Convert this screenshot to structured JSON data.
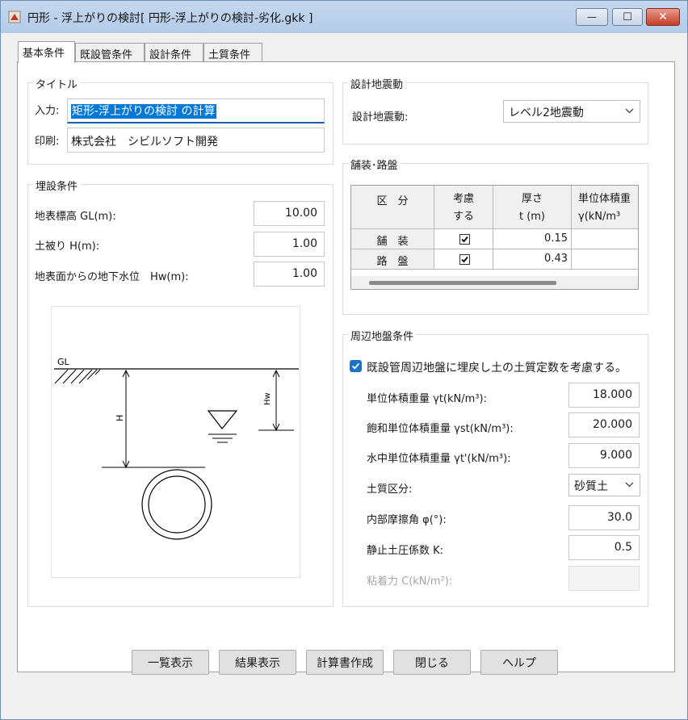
{
  "window": {
    "title": "円形 - 浮上がりの検討[ 円形-浮上がりの検討-劣化.gkk ]",
    "min_glyph": "—",
    "max_glyph": "☐",
    "close_glyph": "✕"
  },
  "tabs": [
    {
      "label": "基本条件",
      "active": true
    },
    {
      "label": "既設管条件",
      "active": false
    },
    {
      "label": "設計条件",
      "active": false
    },
    {
      "label": "土質条件",
      "active": false
    }
  ],
  "title_group": {
    "title": "タイトル",
    "input_label": "入力:",
    "input_value": "矩形-浮上がりの検討 の計算",
    "print_label": "印刷:",
    "print_value": "株式会社　シビルソフト開発"
  },
  "burial": {
    "title": "埋設条件",
    "gl_label": "地表標高 GL(m):",
    "gl_value": "10.00",
    "cover_label": "土被り H(m):",
    "cover_value": "1.00",
    "water_label": "地表面からの地下水位　Hw(m):",
    "water_value": "1.00"
  },
  "diagram": {
    "gl": "GL",
    "h": "H",
    "hw": "Hw"
  },
  "seismic": {
    "title": "設計地震動",
    "label": "設計地震動:",
    "value": "レベル2地震動"
  },
  "pavement": {
    "title": "舗装･路盤",
    "headers": {
      "col1": "区　分",
      "col2_line1": "考慮",
      "col2_line2": "する",
      "col3_line1": "厚さ",
      "col3_line2": "t (m)",
      "col4_line1": "単位体積重",
      "col4_line2": "γ(kN/m³"
    },
    "rows": [
      {
        "name": "舗　装",
        "consider": true,
        "thickness": "0.15"
      },
      {
        "name": "路　盤",
        "consider": true,
        "thickness": "0.43"
      }
    ]
  },
  "ground": {
    "title": "周辺地盤条件",
    "backfill_label": "既設管周辺地盤に埋戻し土の土質定数を考慮する。",
    "backfill_checked": true,
    "unit_weight_label": "単位体積重量 γt(kN/m³):",
    "unit_weight_value": "18.000",
    "sat_weight_label": "飽和単位体積重量 γst(kN/m³):",
    "sat_weight_value": "20.000",
    "sub_weight_label": "水中単位体積重量 γt'(kN/m³):",
    "sub_weight_value": "9.000",
    "soil_label": "土質区分:",
    "soil_value": "砂質土",
    "friction_label": "内部摩擦角 φ(°):",
    "friction_value": "30.0",
    "k_label": "静止土圧係数 K:",
    "k_value": "0.5",
    "cohesion_label": "粘着力 C(kN/m²):",
    "cohesion_value": ""
  },
  "buttons": {
    "list": "一覧表示",
    "result": "結果表示",
    "report": "計算書作成",
    "close": "閉じる",
    "help": "ヘルプ"
  }
}
